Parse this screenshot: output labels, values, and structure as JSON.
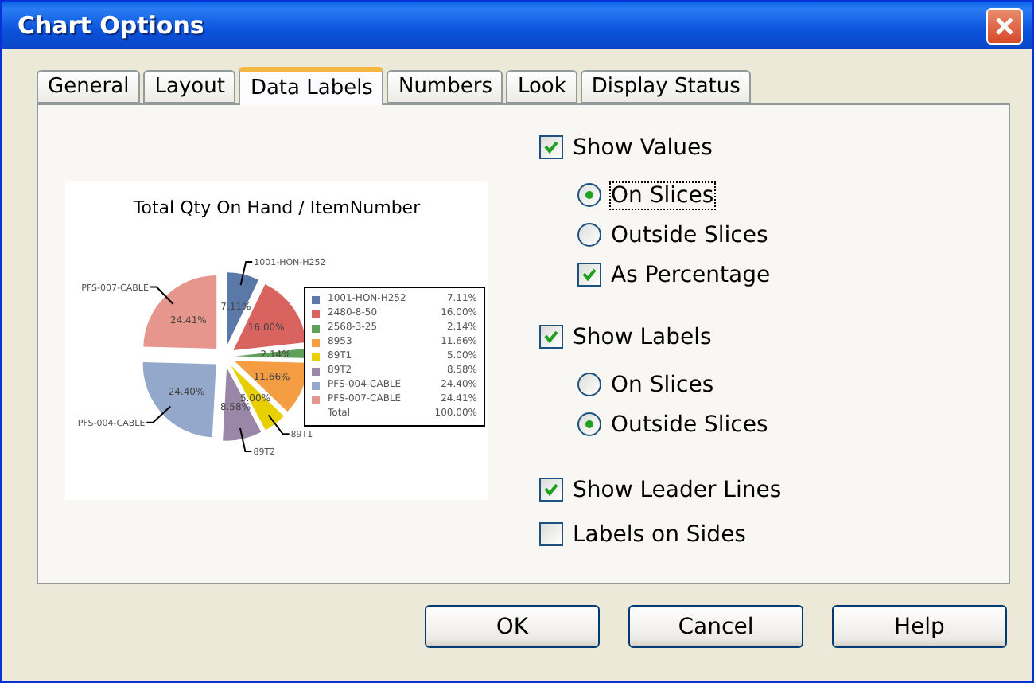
{
  "window": {
    "title": "Chart Options"
  },
  "tabs": [
    {
      "label": "General",
      "selected": false
    },
    {
      "label": "Layout",
      "selected": false
    },
    {
      "label": "Data Labels",
      "selected": true
    },
    {
      "label": "Numbers",
      "selected": false
    },
    {
      "label": "Look",
      "selected": false
    },
    {
      "label": "Display Status",
      "selected": false
    }
  ],
  "preview": {
    "chart_data": {
      "type": "pie",
      "title": "Total Qty On Hand / ItemNumber",
      "categories": [
        "1001-HON-H252",
        "2480-8-50",
        "2568-3-25",
        "8953",
        "89T1",
        "89T2",
        "PFS-004-CABLE",
        "PFS-007-CABLE"
      ],
      "values": [
        7.11,
        16.0,
        2.14,
        11.66,
        5.0,
        8.58,
        24.4,
        24.41
      ],
      "value_labels": [
        "7.11%",
        "16.00%",
        "2.14%",
        "11.66%",
        "5.00%",
        "8.58%",
        "24.40%",
        "24.41%"
      ],
      "legend": "right"
    },
    "leader_labels": [
      "1001-HON-H252",
      "PFS-007-CABLE",
      "PFS-004-CABLE",
      "89T1",
      "89T2"
    ],
    "legend_total": {
      "label": "Total",
      "value": "100.00%"
    }
  },
  "options": [
    {
      "kind": "checkbox",
      "label": "Show Values",
      "checked": true,
      "children": [
        {
          "kind": "radio",
          "label": "On Slices",
          "selected": true
        },
        {
          "kind": "radio",
          "label": "Outside Slices",
          "selected": false
        },
        {
          "kind": "checkbox",
          "label": "As Percentage",
          "checked": true
        }
      ]
    },
    {
      "kind": "checkbox",
      "label": "Show Labels",
      "checked": true,
      "children": [
        {
          "kind": "radio",
          "label": "On Slices",
          "selected": false
        },
        {
          "kind": "radio",
          "label": "Outside Slices",
          "selected": true
        }
      ]
    },
    {
      "kind": "checkbox",
      "label": "Show Leader Lines",
      "checked": true
    },
    {
      "kind": "checkbox",
      "label": "Labels on Sides",
      "checked": false
    }
  ],
  "buttons": [
    "OK",
    "Cancel",
    "Help"
  ]
}
